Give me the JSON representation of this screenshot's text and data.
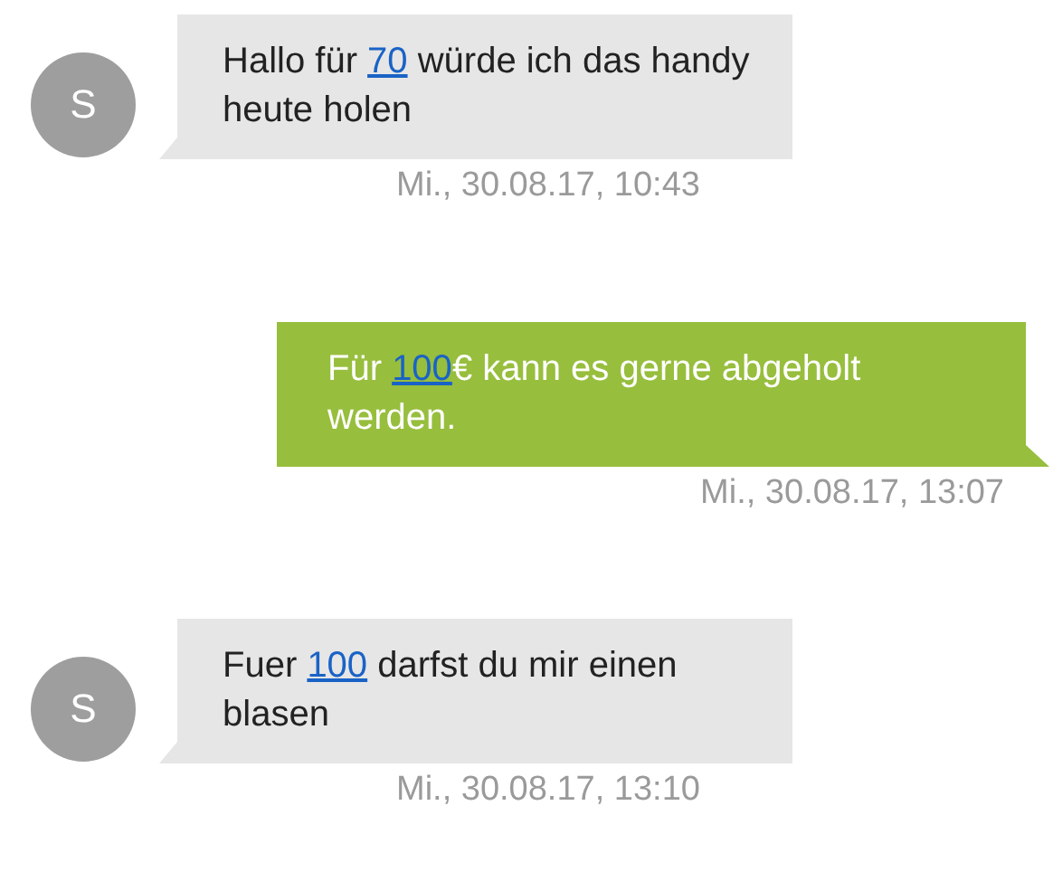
{
  "messages": [
    {
      "kind": "incoming",
      "avatar": "S",
      "segments": [
        {
          "kind": "text",
          "text": "Hallo für "
        },
        {
          "kind": "link",
          "text": "70"
        },
        {
          "kind": "text",
          "text": " würde ich das handy heute holen"
        }
      ],
      "time": "Mi., 30.08.17, 10:43"
    },
    {
      "kind": "outgoing",
      "segments": [
        {
          "kind": "text",
          "text": "Für "
        },
        {
          "kind": "link",
          "text": "100"
        },
        {
          "kind": "text",
          "text": "€ kann es gerne abgeholt werden."
        }
      ],
      "time": "Mi., 30.08.17, 13:07"
    },
    {
      "kind": "incoming",
      "avatar": "S",
      "segments": [
        {
          "kind": "text",
          "text": "Fuer "
        },
        {
          "kind": "link",
          "text": "100"
        },
        {
          "kind": "text",
          "text": " darfst du mir einen blasen"
        }
      ],
      "time": "Mi., 30.08.17, 13:10"
    }
  ]
}
